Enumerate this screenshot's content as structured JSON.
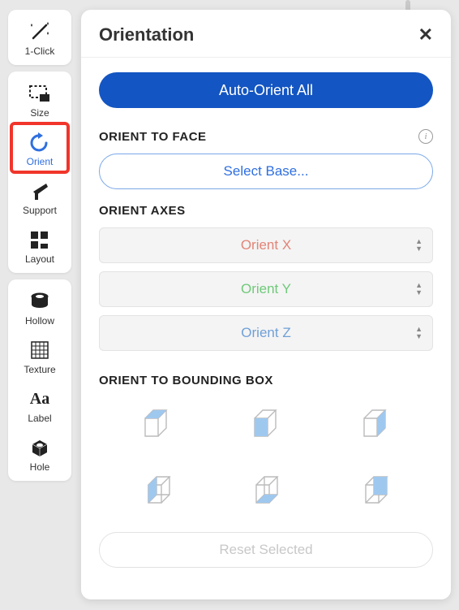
{
  "sidebar": {
    "groups": [
      {
        "items": [
          {
            "id": "oneclick",
            "label": "1-Click"
          }
        ]
      },
      {
        "items": [
          {
            "id": "size",
            "label": "Size"
          },
          {
            "id": "orient",
            "label": "Orient",
            "active": true
          },
          {
            "id": "support",
            "label": "Support"
          },
          {
            "id": "layout",
            "label": "Layout"
          }
        ]
      },
      {
        "items": [
          {
            "id": "hollow",
            "label": "Hollow"
          },
          {
            "id": "texture",
            "label": "Texture"
          },
          {
            "id": "label",
            "label": "Label"
          },
          {
            "id": "hole",
            "label": "Hole"
          }
        ]
      }
    ]
  },
  "panel": {
    "title": "Orientation",
    "auto_orient": "Auto-Orient All",
    "face_title": "ORIENT TO FACE",
    "select_base": "Select Base...",
    "axes_title": "ORIENT AXES",
    "axes": {
      "x": "Orient X",
      "y": "Orient Y",
      "z": "Orient Z"
    },
    "bbox_title": "ORIENT TO BOUNDING BOX",
    "reset": "Reset Selected"
  }
}
